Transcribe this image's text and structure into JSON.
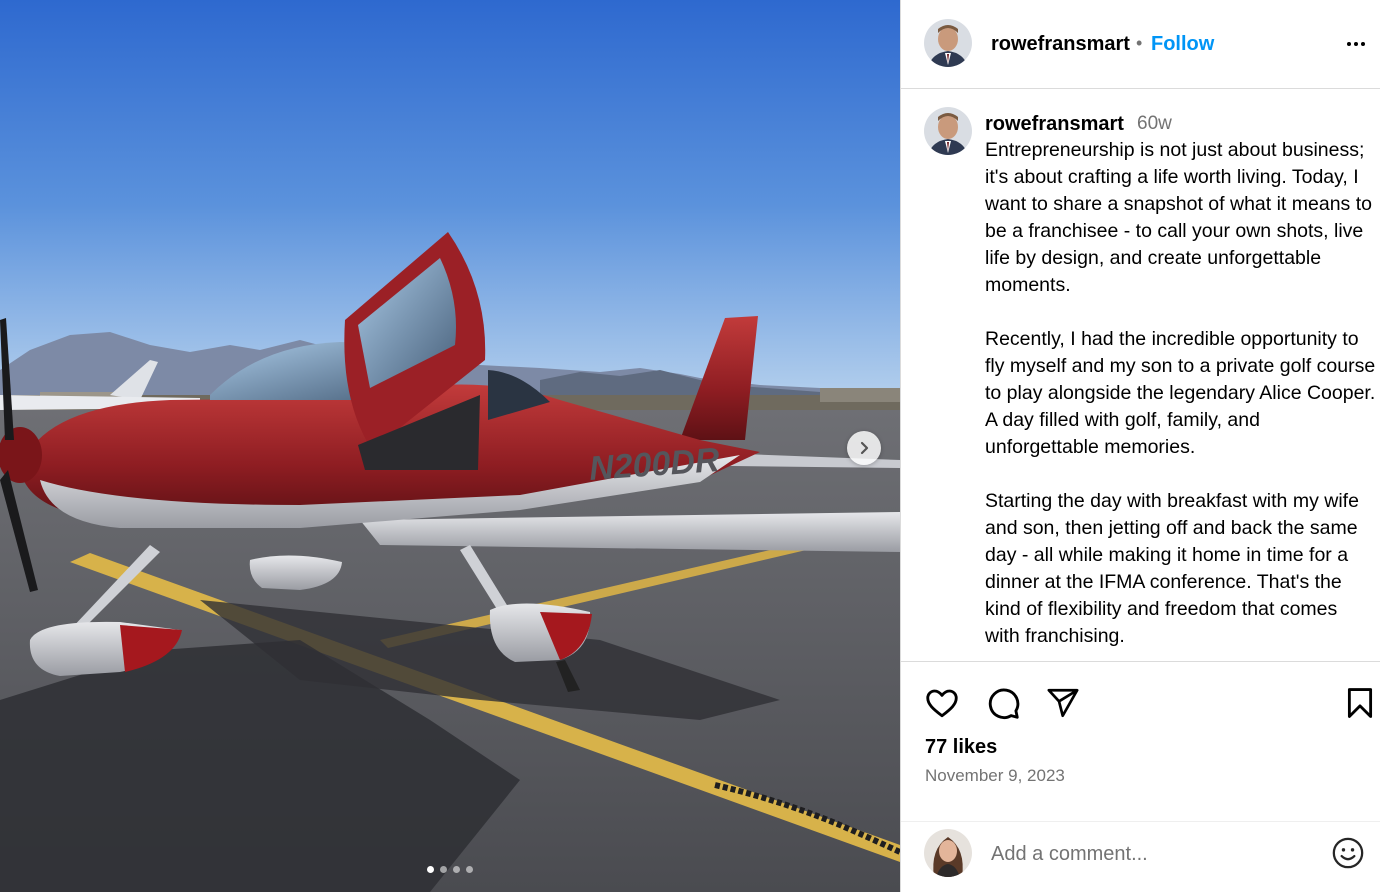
{
  "post": {
    "username": "rowefransmart",
    "follow_label": "Follow",
    "separator": "•",
    "time_ago": "60w",
    "caption_paragraphs": [
      "Entrepreneurship is not just about business; it's about crafting a life worth living. Today, I want to share a snapshot of what it means to be a franchisee - to call your own shots, live life by design, and create unforgettable moments.",
      "Recently, I had the incredible opportunity to fly myself and my son to a private golf course to play alongside the legendary Alice Cooper. A day filled with golf, family, and unforgettable memories.",
      "Starting the day with breakfast with my wife and son, then jetting off and back the same day - all while making it home in time for a dinner at the IFMA conference. That's the kind of flexibility and freedom that comes with franchising."
    ],
    "likes": "77 likes",
    "date": "November 9, 2023",
    "tail_number": "N200DR",
    "carousel_count": 4,
    "carousel_active": 0
  },
  "comment": {
    "placeholder": "Add a comment..."
  },
  "icons": {
    "like": "heart-icon",
    "comment": "comment-bubble-icon",
    "share": "paper-plane-icon",
    "save": "bookmark-icon",
    "more": "more-horizontal-icon",
    "next": "chevron-right-icon",
    "emoji": "emoji-smile-icon"
  },
  "colors": {
    "follow": "#0095f6",
    "secondary_text": "#737373",
    "border": "#dbdbdb"
  }
}
